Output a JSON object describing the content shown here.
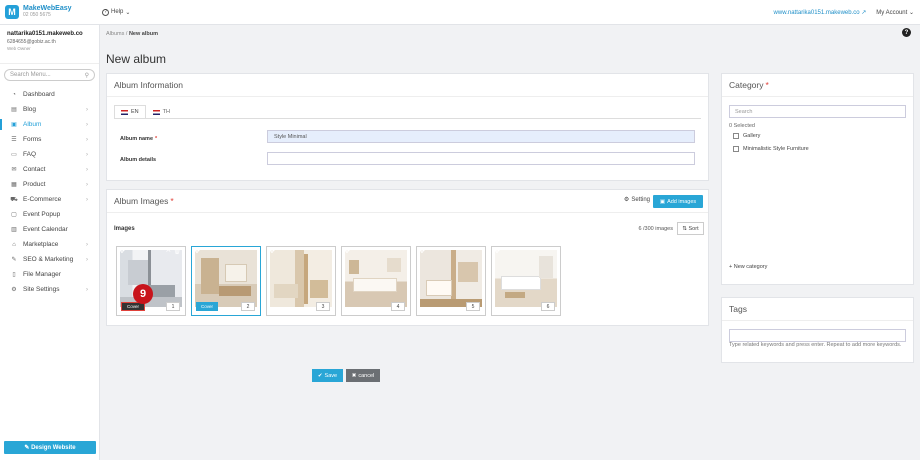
{
  "header": {
    "logo_text": "MakeWebEasy",
    "logo_phone": "02 050 5675",
    "help_label": "Help",
    "site_link": "www.nattarika0151.makeweb.co",
    "account_label": "My Account"
  },
  "user": {
    "site": "nattarika0151.makeweb.co",
    "email": "6284655@gobiz.ac.th",
    "role": "Web Owner"
  },
  "sidebar": {
    "search_placeholder": "Search Menu...",
    "items": [
      {
        "label": "Dashboard",
        "icon": "dashboard-icon"
      },
      {
        "label": "Blog",
        "icon": "blog-icon"
      },
      {
        "label": "Album",
        "icon": "album-icon"
      },
      {
        "label": "Forms",
        "icon": "forms-icon"
      },
      {
        "label": "FAQ",
        "icon": "faq-icon"
      },
      {
        "label": "Contact",
        "icon": "contact-icon"
      },
      {
        "label": "Product",
        "icon": "product-icon"
      },
      {
        "label": "E-Commerce",
        "icon": "ecommerce-icon"
      },
      {
        "label": "Event Popup",
        "icon": "popup-icon"
      },
      {
        "label": "Event Calendar",
        "icon": "calendar-icon"
      },
      {
        "label": "Marketplace",
        "icon": "marketplace-icon"
      },
      {
        "label": "SEO & Marketing",
        "icon": "seo-icon"
      },
      {
        "label": "File Manager",
        "icon": "file-icon"
      },
      {
        "label": "Site Settings",
        "icon": "settings-icon"
      }
    ],
    "design_button": "Design Website"
  },
  "breadcrumb": {
    "parent": "Albums",
    "current": "New album"
  },
  "page_title": "New album",
  "album_info": {
    "title": "Album Information",
    "tabs": [
      "EN",
      "TH"
    ],
    "name_label": "Album name",
    "name_value": "Style Minimal",
    "details_label": "Album details",
    "details_value": ""
  },
  "album_images": {
    "title": "Album Images",
    "setting_label": "Setting",
    "add_label": "Add images",
    "images_label": "Images",
    "count_text": "6 /300 images",
    "sort_label": "Sort",
    "thumbs": [
      "1",
      "2",
      "3",
      "4",
      "5",
      "6"
    ],
    "cover_label": "Cover",
    "badge": "9"
  },
  "actions": {
    "save": "Save",
    "cancel": "cancel"
  },
  "category": {
    "title": "Category",
    "search_placeholder": "Search",
    "selected_text": "0 Selected",
    "items": [
      "Gallery",
      "Minimalistic Style Furniture"
    ],
    "new_label": "New category"
  },
  "tags": {
    "title": "Tags",
    "help": "Type related keywords and press enter. Repeat to add more keywords."
  },
  "colors": {
    "accent": "#29a6d6",
    "required": "#e0413a",
    "badge": "#c8141c"
  }
}
